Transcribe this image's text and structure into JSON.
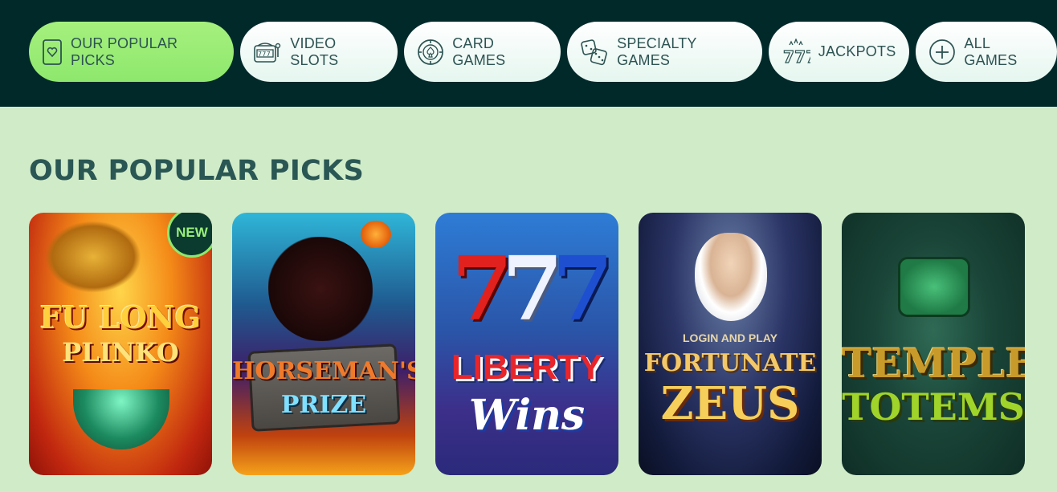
{
  "nav": {
    "items": [
      {
        "label": "OUR POPULAR PICKS",
        "icon": "heart-card-icon",
        "active": true
      },
      {
        "label": "VIDEO SLOTS",
        "icon": "slot-machine-icon",
        "active": false
      },
      {
        "label": "CARD GAMES",
        "icon": "poker-chip-icon",
        "active": false
      },
      {
        "label": "SPECIALTY GAMES",
        "icon": "dice-icon",
        "active": false
      },
      {
        "label": "JACKPOTS",
        "icon": "triple-seven-icon",
        "active": false
      },
      {
        "label": "ALL GAMES",
        "icon": "plus-circle-icon",
        "active": false
      }
    ]
  },
  "section": {
    "title": "OUR POPULAR PICKS"
  },
  "games": [
    {
      "title_line1": "FU LONG",
      "title_line2": "PLINKO",
      "badge": "NEW"
    },
    {
      "title_line1": "HORSEMAN'S",
      "title_line2": "PRIZE"
    },
    {
      "title_line0": "777",
      "title_line1": "LIBERTY",
      "title_line2": "Wins"
    },
    {
      "title_line0": "LOGIN AND PLAY",
      "title_line1": "FORTUNATE",
      "title_line2": "ZEUS"
    },
    {
      "title_line1": "TEMPLE",
      "title_line2": "TOTEMS"
    }
  ],
  "colors": {
    "topbar": "#01292a",
    "page_bg": "#d0ebc8",
    "active_pill": "#97eb73",
    "text_dark": "#2a5654"
  }
}
